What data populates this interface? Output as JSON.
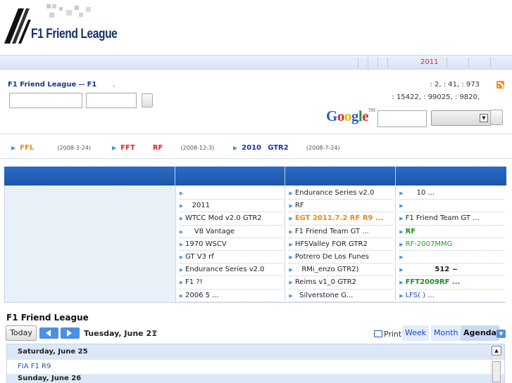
{
  "header": {
    "logo_text": "F1 Friend League"
  },
  "nav": {
    "year": "2011"
  },
  "info": {
    "site_title": "F1 Friend League -- F1",
    "site_dot": ".",
    "stats_line1": ": 2,  : 41,  : 973",
    "stats_line2": ": 15422,  : 99025,  : 9820,"
  },
  "google": {
    "logo": "Google",
    "tm": "TM"
  },
  "ticker": [
    {
      "label": "FFL",
      "date": "(2008-3-24)",
      "color": "#f08a00"
    },
    {
      "label": "FFT",
      "label2": "RF",
      "date": "(2008-12-3)",
      "color": "#e8232f"
    },
    {
      "label": "2010",
      "label2": "GTR2",
      "date": "(2008-7-24)",
      "color": "#1a2fb8"
    }
  ],
  "table": {
    "col1": [
      "",
      "2011",
      "WTCC Mod v2.0 GTR2",
      "V8 Vantage",
      "1970 WSCV",
      "GT   V3 rf",
      "Endurance Series v2.0",
      "F1    ?!",
      "2006     5   ..."
    ],
    "col2": [
      "Endurance Series v2.0",
      "RF",
      "EGT   2011.7.2 RF  R9  ...",
      "F1 Friend Team GT   ...",
      "HFSValley FOR GTR2",
      "Potrero De Los Funes",
      "RMi_enzo  GTR2)",
      "Reims v1_0 GTR2",
      "Silverstone    G..."
    ],
    "col3": [
      "10          ...",
      "",
      "F1 Friend Team GT    ...",
      "RF",
      "RF-2007MMG",
      "",
      "512  ~",
      "FFT2009RF         ...",
      "LFS(  )       ..."
    ]
  },
  "calendar": {
    "title": "F1 Friend League",
    "today_label": "Today",
    "current_date": "Tuesday, June 21",
    "print_label": "Print",
    "views": [
      "Week",
      "Month",
      "Agenda"
    ],
    "active_view": "Agenda",
    "days": [
      {
        "heading": "Saturday, June 25",
        "events": [
          "FIA F1 R9"
        ]
      },
      {
        "heading": "Sunday, June 26",
        "events": []
      }
    ]
  },
  "colors": {
    "accent_blue": "#1b56ad",
    "nav_red": "#e8232f",
    "orange": "#f08a00",
    "green": "#2b9a2b"
  }
}
